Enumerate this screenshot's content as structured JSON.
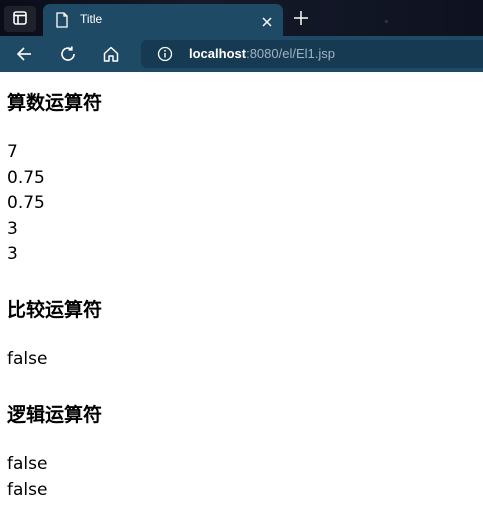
{
  "browser": {
    "tab_title": "Title",
    "url_host": "localhost",
    "url_rest": ":8080/el/El1.jsp",
    "icons": [
      "window-menu-icon",
      "page-icon",
      "close-icon",
      "new-tab-icon",
      "back-icon",
      "refresh-icon",
      "home-icon",
      "info-icon"
    ]
  },
  "page": {
    "sections": [
      {
        "heading": "算数运算符",
        "values": [
          "7",
          "0.75",
          "0.75",
          "3",
          "3"
        ]
      },
      {
        "heading": "比较运算符",
        "values": [
          "false"
        ]
      },
      {
        "heading": "逻辑运算符",
        "values": [
          "false",
          "false"
        ]
      }
    ]
  }
}
